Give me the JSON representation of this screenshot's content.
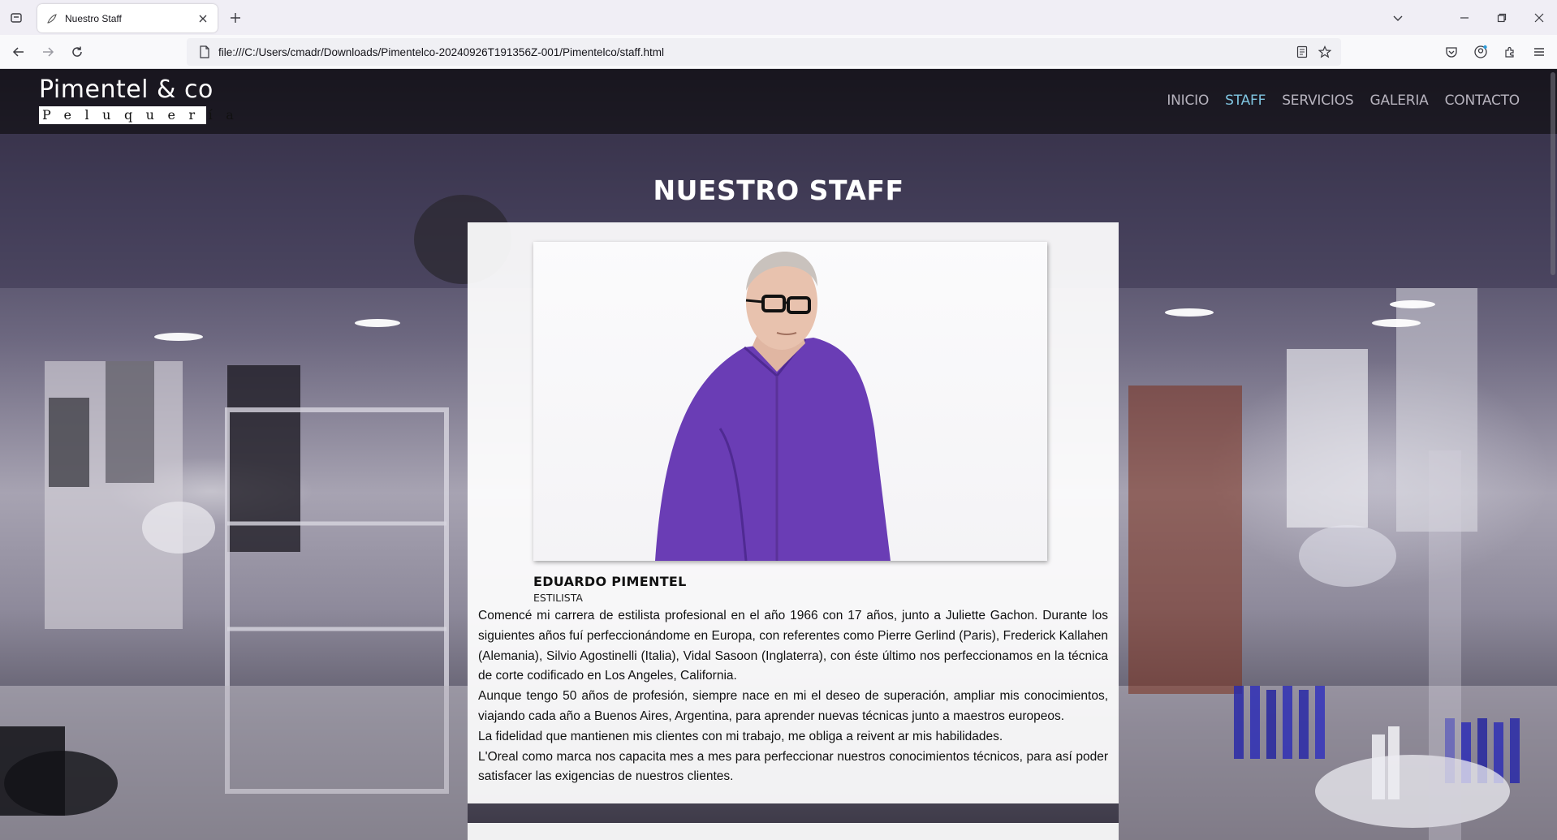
{
  "browser": {
    "tab": {
      "title": "Nuestro Staff",
      "favicon": "feather-icon"
    },
    "url": "file:///C:/Users/cmadr/Downloads/Pimentelco-20240926T191356Z-001/Pimentelco/staff.html"
  },
  "site": {
    "logo": {
      "name": "Pimentel & co",
      "subtitle": "Peluquería"
    },
    "nav": [
      {
        "label": "INICIO",
        "active": false
      },
      {
        "label": "STAFF",
        "active": true
      },
      {
        "label": "SERVICIOS",
        "active": false
      },
      {
        "label": "GALERIA",
        "active": false
      },
      {
        "label": "CONTACTO",
        "active": false
      }
    ],
    "title": "NUESTRO STAFF",
    "staff": {
      "name": "EDUARDO PIMENTEL",
      "role": "ESTILISTA",
      "bio": [
        "Comencé mi carrera de estilista profesional en el año 1966 con 17 años, junto a Juliette Gachon. Durante los siguientes años fuí perfeccionándome en Europa, con referentes como Pierre Gerlind (Paris), Frederick Kallahen (Alemania), Silvio Agostinelli (Italia), Vidal Sasoon (Inglaterra), con éste último nos perfeccionamos en la técnica de corte codificado en Los Angeles, California.",
        "Aunque tengo 50 años de profesión, siempre nace en mi el deseo de superación, ampliar mis conocimientos, viajando cada año a Buenos Aires, Argentina, para aprender nuevas técnicas junto a maestros europeos.",
        "La fidelidad que mantienen mis clientes con mi trabajo, me obliga a reivent ar mis habilidades.",
        "L'Oreal como marca nos capacita mes a mes para perfeccionar nuestros conocimientos técnicos, para así poder satisfacer las exigencias de nuestros clientes."
      ]
    }
  },
  "colors": {
    "nav_active": "#7fc4e0",
    "nav_inactive": "#b7b3be",
    "shirt": "#6a3db5"
  }
}
